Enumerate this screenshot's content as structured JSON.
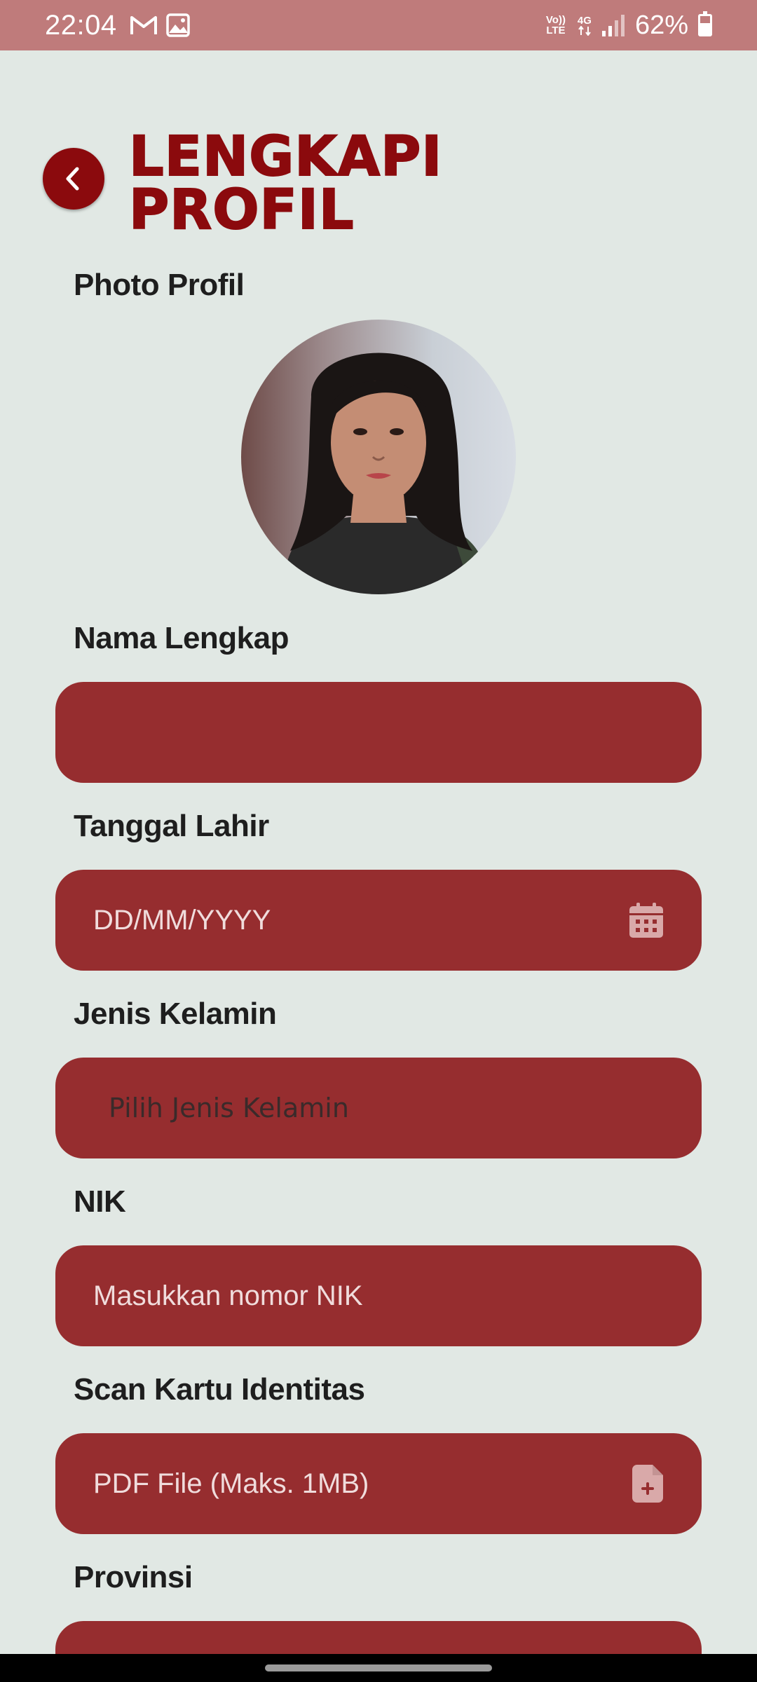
{
  "status_bar": {
    "time": "22:04",
    "network_volte": "Vo)) LTE",
    "network_4g": "4G",
    "battery": "62%",
    "battery_level": 0.62,
    "icons": [
      "gmail-icon",
      "gallery-icon",
      "signal-icon",
      "battery-icon"
    ]
  },
  "header": {
    "back_icon": "chevron-left-icon",
    "title_line1": "LENGKAPI",
    "title_line2": "PROFIL"
  },
  "form": {
    "photo_label": "Photo Profil",
    "full_name": {
      "label": "Nama Lengkap",
      "value": "",
      "placeholder": ""
    },
    "birth_date": {
      "label": "Tanggal Lahir",
      "placeholder": "DD/MM/YYYY",
      "icon": "calendar-icon"
    },
    "gender": {
      "label": "Jenis Kelamin",
      "placeholder": "Pilih Jenis Kelamin"
    },
    "nik": {
      "label": "NIK",
      "placeholder": "Masukkan nomor NIK"
    },
    "id_scan": {
      "label": "Scan Kartu Identitas",
      "placeholder": "PDF File (Maks. 1MB)",
      "icon": "file-add-icon"
    },
    "province": {
      "label": "Provinsi",
      "value": ""
    }
  },
  "colors": {
    "background": "#e1e8e4",
    "status_bar": "#bf7b7b",
    "accent": "#8b0a0d",
    "field": "#962d2f",
    "field_text": "#f0dcdc",
    "label_text": "#1e1e1e"
  }
}
